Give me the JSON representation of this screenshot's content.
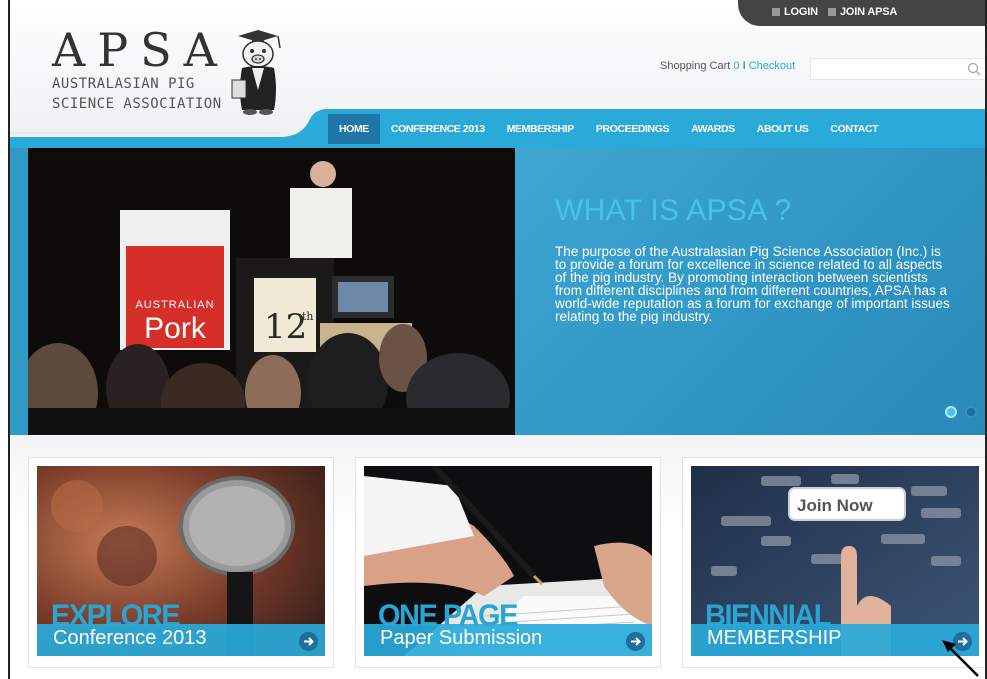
{
  "header": {
    "logo_letters": "APSA",
    "logo_line1": "AUSTRALASIAN PIG",
    "logo_line2": "SCIENCE ASSOCIATION",
    "cart_label": "Shopping Cart",
    "cart_count": "0",
    "cart_sep": "I",
    "checkout": "Checkout",
    "search_placeholder": ""
  },
  "toplinks": {
    "login": "LOGIN",
    "join": "JOIN APSA"
  },
  "nav": {
    "items": [
      {
        "label": "HOME",
        "active": true
      },
      {
        "label": "CONFERENCE 2013"
      },
      {
        "label": "MEMBERSHIP"
      },
      {
        "label": "PROCEEDINGS"
      },
      {
        "label": "AWARDS"
      },
      {
        "label": "ABOUT US"
      },
      {
        "label": "CONTACT"
      }
    ]
  },
  "hero": {
    "title": "WHAT IS APSA ?",
    "text": "The purpose of the Australasian Pig Science Association (Inc.) is to provide a forum for excellence in science related to all aspects of the pig industry. By promoting interaction between scientists from different disciplines and from different countries, APSA has a world-wide reputation as a forum for exchange of important issues relating to the pig industry.",
    "banner_word1": "AUSTRALIAN",
    "banner_word2": "Pork",
    "podium_number": "12",
    "podium_suffix": "th",
    "slide_count": 2,
    "active_slide": 1
  },
  "cards": [
    {
      "big": "EXPLORE",
      "sub": "Conference 2013"
    },
    {
      "big": "ONE PAGE",
      "sub": "Paper Submission"
    },
    {
      "big": "BIENNIAL",
      "sub": "MEMBERSHIP",
      "sign": "Join Now"
    }
  ],
  "colors": {
    "accent": "#29aada",
    "nav_active": "#1f76a8",
    "hero_blue": "#2f94c3",
    "hero_title": "#49c1ea"
  }
}
